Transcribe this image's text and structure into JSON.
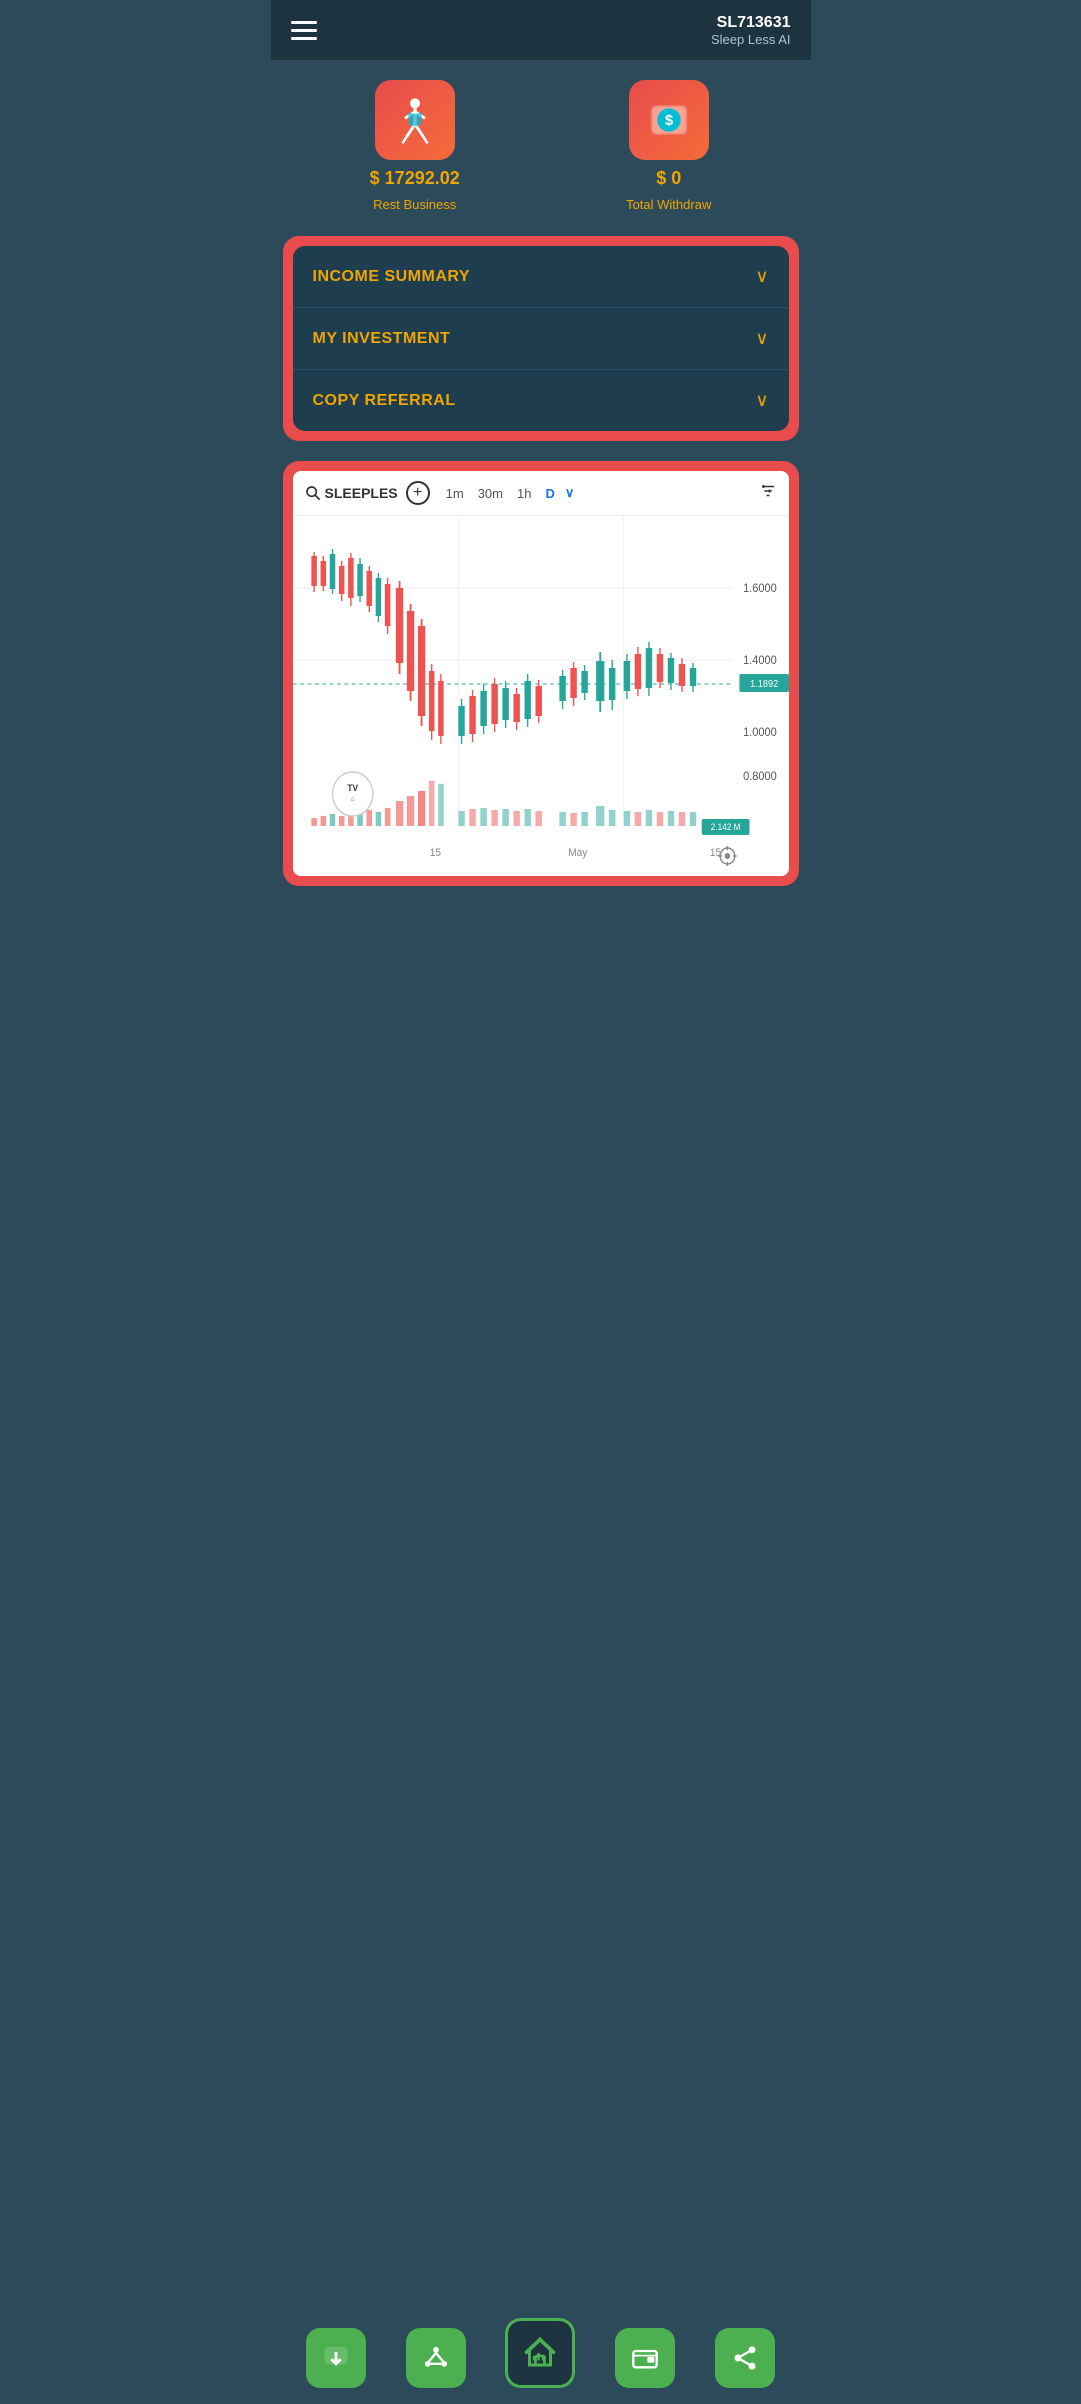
{
  "header": {
    "user_id": "SL713631",
    "subtitle": "Sleep Less AI"
  },
  "cards": [
    {
      "value": "$ 17292.02",
      "label": "Rest Business",
      "icon": "walk-icon"
    },
    {
      "value": "$ 0",
      "label": "Total Withdraw",
      "icon": "withdraw-icon"
    }
  ],
  "accordion": {
    "items": [
      {
        "label": "INCOME SUMMARY"
      },
      {
        "label": "MY INVESTMENT"
      },
      {
        "label": "COPY REFERRAL"
      }
    ]
  },
  "chart": {
    "symbol": "SLEEPLES",
    "timeframes": [
      "1m",
      "30m",
      "1h",
      "D"
    ],
    "active_tf": "D",
    "price_current": "1.1892",
    "price_1": "1.6000",
    "price_2": "1.4000",
    "price_3": "1.0000",
    "price_4": "0.8000",
    "volume_label": "2.142 M",
    "x_labels": [
      "15",
      "May",
      "15"
    ],
    "tv_watermark": "TV"
  },
  "bottom_nav": [
    {
      "name": "download-nav",
      "icon": "⬇",
      "label": "withdraw"
    },
    {
      "name": "network-nav",
      "icon": "⬡",
      "label": "network"
    },
    {
      "name": "home-nav",
      "icon": "🏠",
      "label": "home",
      "is_home": true
    },
    {
      "name": "wallet-nav",
      "icon": "▣",
      "label": "wallet"
    },
    {
      "name": "share-nav",
      "icon": "⇗",
      "label": "share"
    }
  ]
}
